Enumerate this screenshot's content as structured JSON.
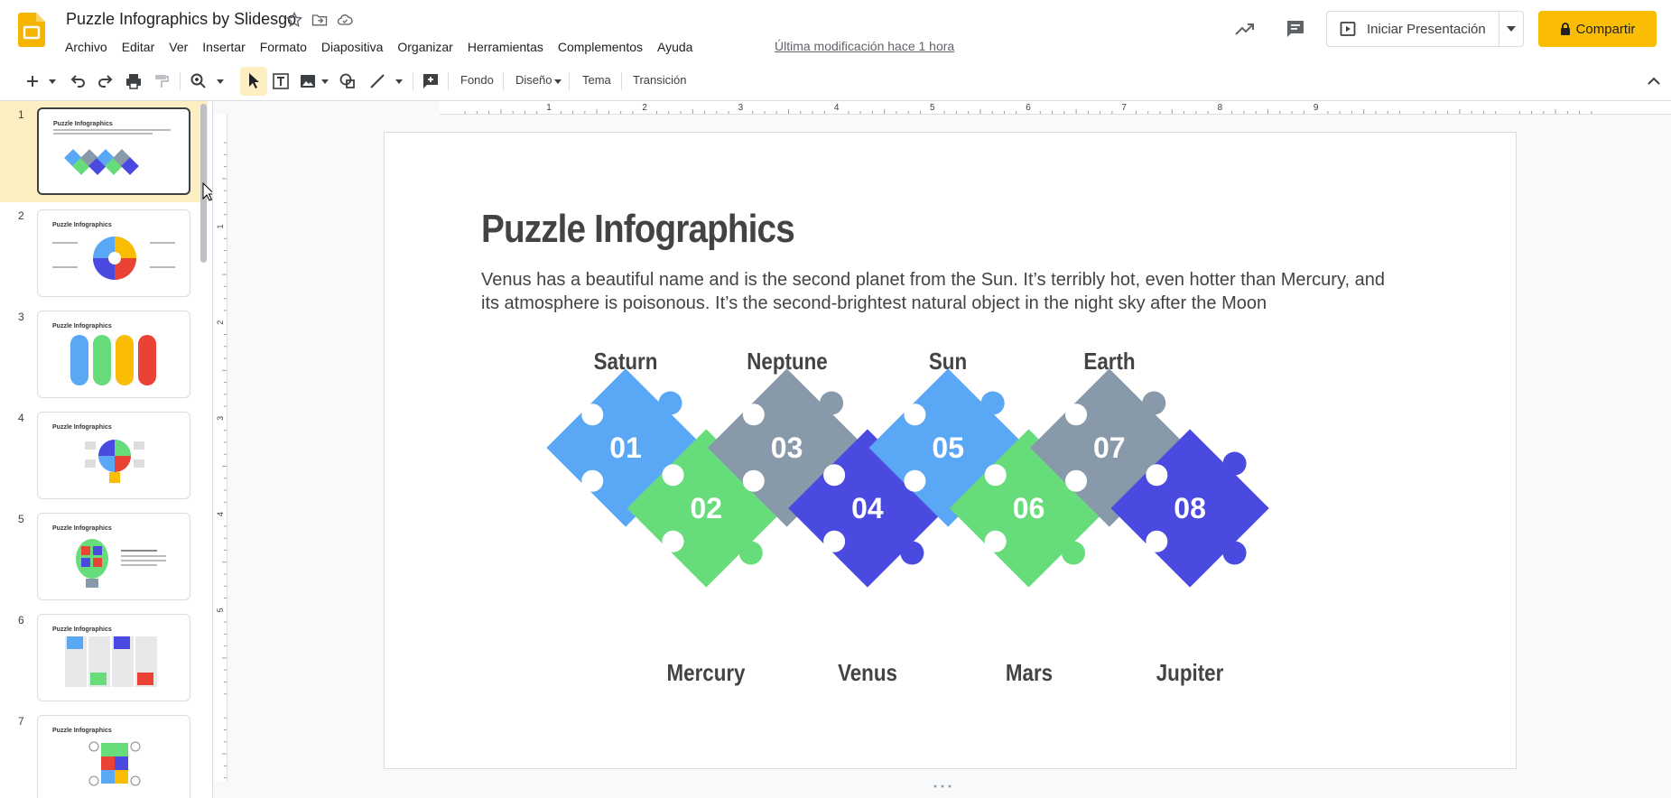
{
  "header": {
    "doc_title": "Puzzle Infographics by Slidesgo",
    "menu": [
      "Archivo",
      "Editar",
      "Ver",
      "Insertar",
      "Formato",
      "Diapositiva",
      "Organizar",
      "Herramientas",
      "Complementos",
      "Ayuda"
    ],
    "last_modified": "Última modificación hace 1 hora",
    "present_label": "Iniciar Presentación",
    "share_label": "Compartir",
    "colors": {
      "share_bg": "#fbbc04",
      "logo": "#f4b400"
    }
  },
  "toolbar": {
    "background_label": "Fondo",
    "layout_label": "Diseño",
    "theme_label": "Tema",
    "transition_label": "Transición",
    "icons": [
      "plus-icon",
      "chevron-down-icon",
      "undo-icon",
      "redo-icon",
      "print-icon",
      "paint-format-icon",
      "zoom-icon",
      "select-icon",
      "text-box-icon",
      "image-icon",
      "shape-icon",
      "line-icon",
      "comment-add-icon",
      "collapse-icon"
    ]
  },
  "filmstrip": {
    "slides": [
      {
        "num": "1",
        "title": "Puzzle Infographics"
      },
      {
        "num": "2",
        "title": "Puzzle Infographics"
      },
      {
        "num": "3",
        "title": "Puzzle Infographics"
      },
      {
        "num": "4",
        "title": "Puzzle Infographics"
      },
      {
        "num": "5",
        "title": "Puzzle Infographics"
      },
      {
        "num": "6",
        "title": "Puzzle Infographics"
      },
      {
        "num": "7",
        "title": "Puzzle Infographics"
      }
    ],
    "selected": "1"
  },
  "ruler": {
    "h_marks": [
      "1",
      "2",
      "3",
      "4",
      "5",
      "6",
      "7",
      "8",
      "9"
    ],
    "v_marks": [
      "1",
      "2",
      "3",
      "4",
      "5"
    ]
  },
  "slide": {
    "title": "Puzzle Infographics",
    "body": "Venus has a beautiful name and is the second planet from the Sun. It’s terribly hot, even hotter than Mercury, and its atmosphere is poisonous. It’s the second-brightest natural object in the night sky after the Moon",
    "top_labels": [
      "Saturn",
      "Neptune",
      "Sun",
      "Earth"
    ],
    "bottom_labels": [
      "Mercury",
      "Venus",
      "Mars",
      "Jupiter"
    ],
    "pieces": [
      {
        "num": "01",
        "color": "#5aa8f5"
      },
      {
        "num": "02",
        "color": "#66dd7a"
      },
      {
        "num": "03",
        "color": "#8899aa"
      },
      {
        "num": "04",
        "color": "#4a4ae0"
      },
      {
        "num": "05",
        "color": "#5aa8f5"
      },
      {
        "num": "06",
        "color": "#66dd7a"
      },
      {
        "num": "07",
        "color": "#8899aa"
      },
      {
        "num": "08",
        "color": "#4a4ae0"
      }
    ]
  }
}
